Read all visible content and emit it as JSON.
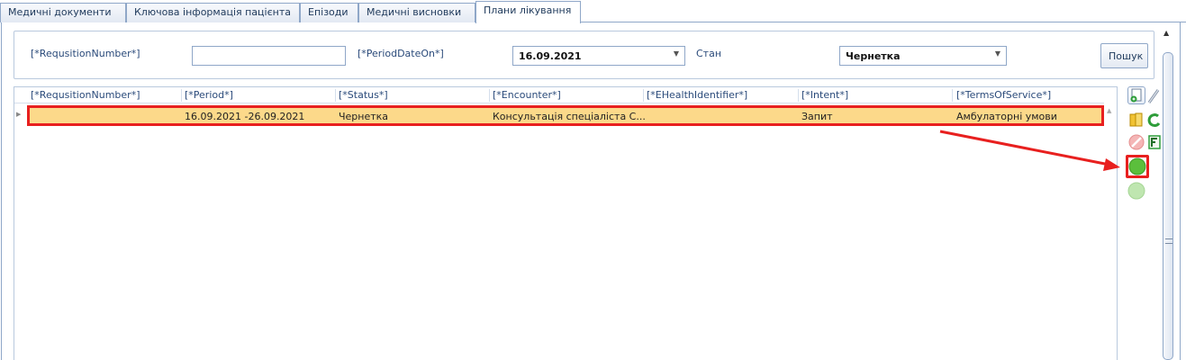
{
  "tabs": [
    {
      "label": "Медичні документи"
    },
    {
      "label": "Ключова інформація пацієнта"
    },
    {
      "label": "Епізоди"
    },
    {
      "label": "Медичні висновки"
    },
    {
      "label": "Плани лікування"
    }
  ],
  "active_tab_index": 4,
  "filter": {
    "requisition_label": "[*RequsitionNumber*]",
    "requisition_value": "",
    "period_label": "[*PeriodDateOn*]",
    "period_value": "16.09.2021",
    "state_label": "Стан",
    "state_value": "Чернетка",
    "search_button": "Пошук"
  },
  "grid": {
    "columns": [
      "[*RequsitionNumber*]",
      "[*Period*]",
      "[*Status*]",
      "[*Encounter*]",
      "[*EHealthIdentifier*]",
      "[*Intent*]",
      "[*TermsOfService*]"
    ],
    "rows": [
      {
        "requisition_number": "",
        "period": "16.09.2021 -26.09.2021",
        "status": "Чернетка",
        "encounter": "Консультація спеціаліста С...",
        "ehealth_identifier": "",
        "intent": "Запит",
        "terms_of_service": "Амбулаторні умови"
      }
    ],
    "selected_row_index": 0
  },
  "side_toolbar": [
    {
      "icon": "add-document-icon"
    },
    {
      "icon": "edit-pencil-icon"
    },
    {
      "icon": "book-icon"
    },
    {
      "icon": "refresh-icon"
    },
    {
      "icon": "cancel-icon"
    },
    {
      "icon": "sign-flag-icon"
    },
    {
      "icon": "green-circle-icon"
    },
    {
      "icon": "light-green-circle-icon"
    }
  ],
  "colors": {
    "selected_row": "#fcd98a",
    "highlight": "#e8201f",
    "border": "#8fa7c8",
    "header_text": "#2a4a7a"
  }
}
